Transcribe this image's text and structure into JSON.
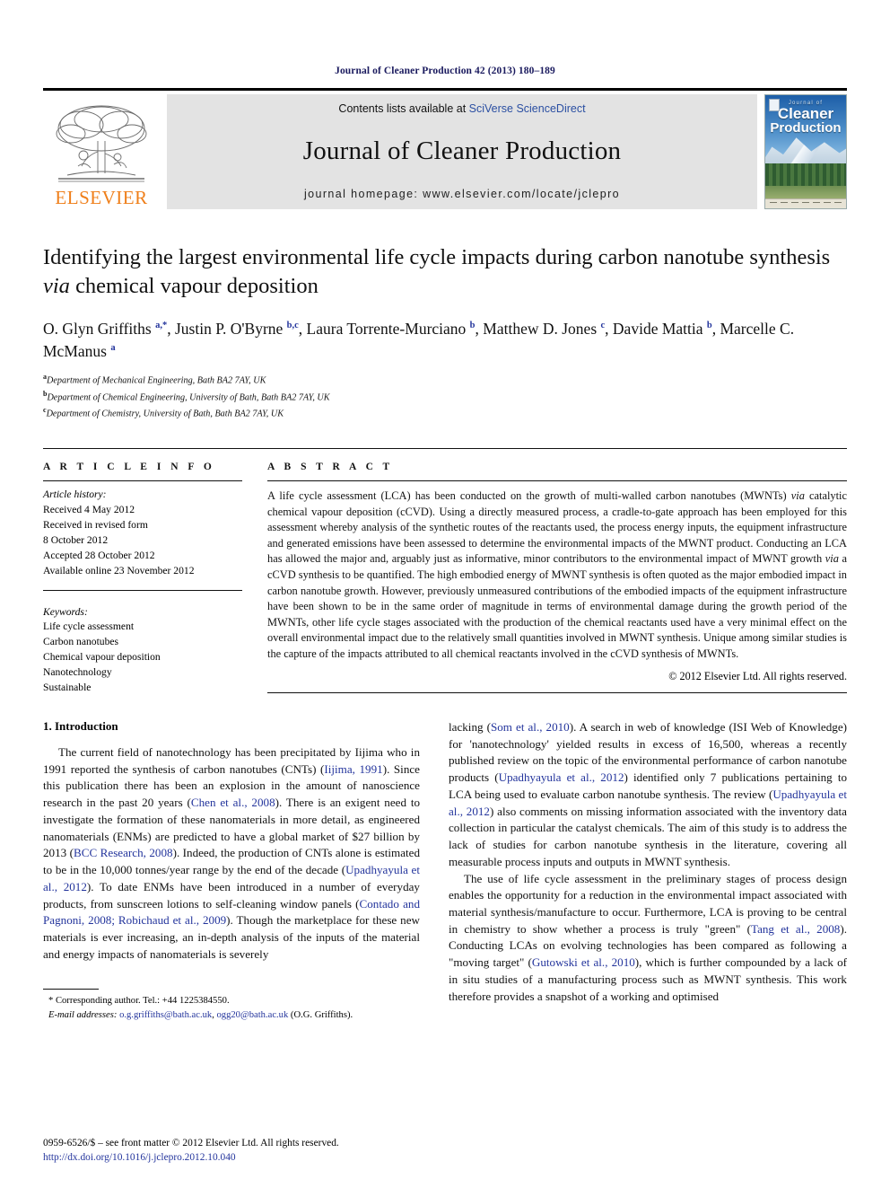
{
  "running_head": "Journal of Cleaner Production 42 (2013) 180–189",
  "masthead": {
    "publisher": "ELSEVIER",
    "contents_prefix": "Contents lists available at ",
    "contents_link": "SciVerse ScienceDirect",
    "journal_name": "Journal of Cleaner Production",
    "homepage": "journal homepage: www.elsevier.com/locate/jclepro",
    "cover": {
      "line1": "Journal of",
      "line2": "Cleaner",
      "line3": "Production"
    }
  },
  "article": {
    "title_line1": "Identifying the largest environmental life cycle impacts during carbon nanotube",
    "title_line2_pre": "synthesis ",
    "title_line2_ital": "via",
    "title_line2_post": " chemical vapour deposition",
    "authors_html": "O. Glyn Griffiths <sup>a,</sup><sup class=\"star\">*</sup>, Justin P. O'Byrne <sup>b,c</sup>, Laura Torrente-Murciano <sup>b</sup>, Matthew D. Jones <sup>c</sup>, Davide Mattia <sup>b</sup>, Marcelle C. McManus <sup>a</sup>",
    "affiliations": [
      {
        "mark": "a",
        "text": "Department of Mechanical Engineering, Bath BA2 7AY, UK"
      },
      {
        "mark": "b",
        "text": "Department of Chemical Engineering, University of Bath, Bath BA2 7AY, UK"
      },
      {
        "mark": "c",
        "text": "Department of Chemistry, University of Bath, Bath BA2 7AY, UK"
      }
    ]
  },
  "article_info": {
    "heading": "A R T I C L E   I N F O",
    "history_label": "Article history:",
    "history": [
      "Received 4 May 2012",
      "Received in revised form",
      "8 October 2012",
      "Accepted 28 October 2012",
      "Available online 23 November 2012"
    ],
    "keywords_label": "Keywords:",
    "keywords": [
      "Life cycle assessment",
      "Carbon nanotubes",
      "Chemical vapour deposition",
      "Nanotechnology",
      "Sustainable"
    ]
  },
  "abstract": {
    "heading": "A B S T R A C T",
    "text_html": "A life cycle assessment (LCA) has been conducted on the growth of multi-walled carbon nanotubes (MWNTs) <span class=\"ital\">via</span> catalytic chemical vapour deposition (cCVD). Using a directly measured process, a cradle-to-gate approach has been employed for this assessment whereby analysis of the synthetic routes of the reactants used, the process energy inputs, the equipment infrastructure and generated emissions have been assessed to determine the environmental impacts of the MWNT product. Conducting an LCA has allowed the major and, arguably just as informative, minor contributors to the environmental impact of MWNT growth <span class=\"ital\">via</span> a cCVD synthesis to be quantified. The high embodied energy of MWNT synthesis is often quoted as the major embodied impact in carbon nanotube growth. However, previously unmeasured contributions of the embodied impacts of the equipment infrastructure have been shown to be in the same order of magnitude in terms of environmental damage during the growth period of the MWNTs, other life cycle stages associated with the production of the chemical reactants used have a very minimal effect on the overall environmental impact due to the relatively small quantities involved in MWNT synthesis. Unique among similar studies is the capture of the impacts attributed to all chemical reactants involved in the cCVD synthesis of MWNTs.",
    "copyright": "© 2012 Elsevier Ltd. All rights reserved."
  },
  "body": {
    "section_heading": "1. Introduction",
    "left_paragraphs_html": [
      "The current field of nanotechnology has been precipitated by Iijima who in 1991 reported the synthesis of carbon nanotubes (CNTs) (<span class=\"cit\">Iijima, 1991</span>). Since this publication there has been an explosion in the amount of nanoscience research in the past 20 years (<span class=\"cit\">Chen et al., 2008</span>). There is an exigent need to investigate the formation of these nanomaterials in more detail, as engineered nanomaterials (ENMs) are predicted to have a global market of $27 billion by 2013 (<span class=\"cit\">BCC Research, 2008</span>). Indeed, the production of CNTs alone is estimated to be in the 10,000 tonnes/year range by the end of the decade (<span class=\"cit\">Upadhyayula et al., 2012</span>). To date ENMs have been introduced in a number of everyday products, from sunscreen lotions to self-cleaning window panels (<span class=\"cit\">Contado and Pagnoni, 2008; Robichaud et al., 2009</span>). Though the marketplace for these new materials is ever increasing, an in-depth analysis of the inputs of the material and energy impacts of nanomaterials is severely"
    ],
    "right_paragraphs_html": [
      "lacking (<span class=\"cit\">Som et al., 2010</span>). A search in web of knowledge (ISI Web of Knowledge) for 'nanotechnology' yielded results in excess of 16,500, whereas a recently published review on the topic of the environmental performance of carbon nanotube products (<span class=\"cit\">Upadhyayula et al., 2012</span>) identified only 7 publications pertaining to LCA being used to evaluate carbon nanotube synthesis. The review (<span class=\"cit\">Upadhyayula et al., 2012</span>) also comments on missing information associated with the inventory data collection in particular the catalyst chemicals. The aim of this study is to address the lack of studies for carbon nanotube synthesis in the literature, covering all measurable process inputs and outputs in MWNT synthesis.",
      "The use of life cycle assessment in the preliminary stages of process design enables the opportunity for a reduction in the environmental impact associated with material synthesis/manufacture to occur. Furthermore, LCA is proving to be central in chemistry to show whether a process is truly \"green\" (<span class=\"cit\">Tang et al., 2008</span>). Conducting LCAs on evolving technologies has been compared as following a \"moving target\" (<span class=\"cit\">Gutowski et al., 2010</span>), which is further compounded by a lack of <span class=\"ital\">in situ</span> studies of a manufacturing process such as MWNT synthesis. This work therefore provides a snapshot of a working and optimised"
    ]
  },
  "footnote": {
    "corresponding_html": "* Corresponding author. Tel.: +44 1225384550.",
    "emails_html": "<span class=\"lab\">E-mail addresses:</span> <span class=\"mail\">o.g.griffiths@bath.ac.uk</span>, <span class=\"mail\">ogg20@bath.ac.uk</span> (O.G. Griffiths)."
  },
  "footer": {
    "issn_line": "0959-6526/$ – see front matter © 2012 Elsevier Ltd. All rights reserved.",
    "doi": "http://dx.doi.org/10.1016/j.jclepro.2012.10.040"
  },
  "colors": {
    "link_blue": "#23349c",
    "sciencedirect_blue": "#2b4fa2",
    "elsevier_orange": "#ef7f1a",
    "running_head_navy": "#1a1a5e",
    "masthead_grey": "#e3e3e3"
  }
}
